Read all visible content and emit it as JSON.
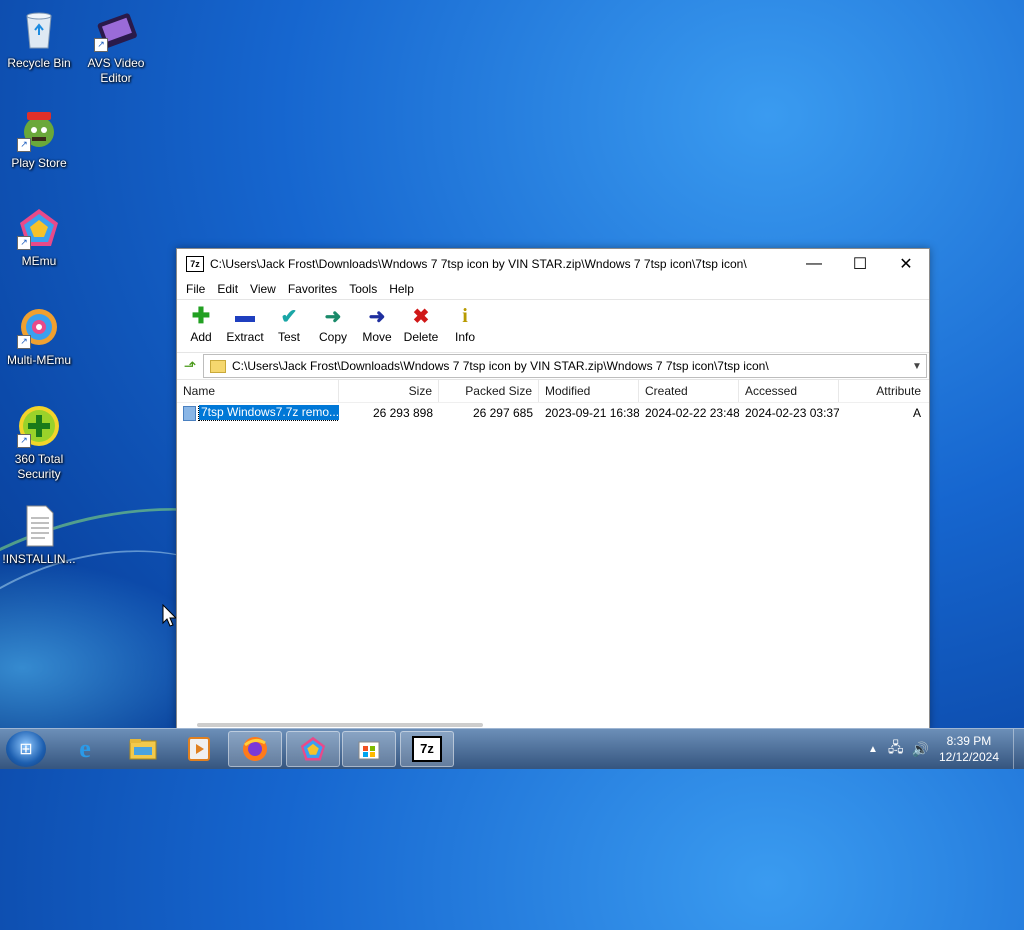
{
  "desktop": {
    "icons": [
      {
        "label": "Recycle Bin"
      },
      {
        "label": "AVS Video Editor"
      },
      {
        "label": "Play Store"
      },
      {
        "label": "MEmu"
      },
      {
        "label": "Multi-MEmu"
      },
      {
        "label": "360 Total Security"
      },
      {
        "label": "!INSTALLIN..."
      }
    ]
  },
  "window": {
    "app_icon": "7z",
    "title": "C:\\Users\\Jack Frost\\Downloads\\Wndows 7 7tsp icon by VIN STAR.zip\\Wndows 7 7tsp icon\\7tsp icon\\",
    "controls": {
      "minimize": "—",
      "maximize": "☐",
      "close": "✕"
    },
    "menu": [
      "File",
      "Edit",
      "View",
      "Favorites",
      "Tools",
      "Help"
    ],
    "toolbar": [
      {
        "label": "Add",
        "icon": "plus-icon",
        "glyph": "✚",
        "color": "#22a022"
      },
      {
        "label": "Extract",
        "icon": "minus-icon",
        "glyph": "▬",
        "color": "#1f3fbf"
      },
      {
        "label": "Test",
        "icon": "check-icon",
        "glyph": "✔",
        "color": "#1aa6a6"
      },
      {
        "label": "Copy",
        "icon": "copy-arrow-icon",
        "glyph": "➜",
        "color": "#1a8a6a"
      },
      {
        "label": "Move",
        "icon": "move-arrow-icon",
        "glyph": "➜",
        "color": "#1f2f9f"
      },
      {
        "label": "Delete",
        "icon": "delete-x-icon",
        "glyph": "✖",
        "color": "#d01818"
      },
      {
        "label": "Info",
        "icon": "info-icon",
        "glyph": "i",
        "color": "#b89a00"
      }
    ],
    "address": "C:\\Users\\Jack Frost\\Downloads\\Wndows 7 7tsp icon by VIN STAR.zip\\Wndows 7 7tsp icon\\7tsp icon\\",
    "columns": [
      "Name",
      "Size",
      "Packed Size",
      "Modified",
      "Created",
      "Accessed",
      "Attribute"
    ],
    "rows": [
      {
        "name": "7tsp Windows7.7z remo...",
        "size": "26 293 898",
        "packed": "26 297 685",
        "modified": "2023-09-21 16:38",
        "created": "2024-02-22 23:48",
        "accessed": "2024-02-23 03:37",
        "attribute": "A"
      }
    ]
  },
  "taskbar": {
    "apps": [
      "internet-explorer-icon",
      "file-explorer-icon",
      "media-player-icon",
      "firefox-icon",
      "memu-icon",
      "store-icon",
      "7zip-icon"
    ],
    "time": "8:39 PM",
    "date": "12/12/2024"
  }
}
